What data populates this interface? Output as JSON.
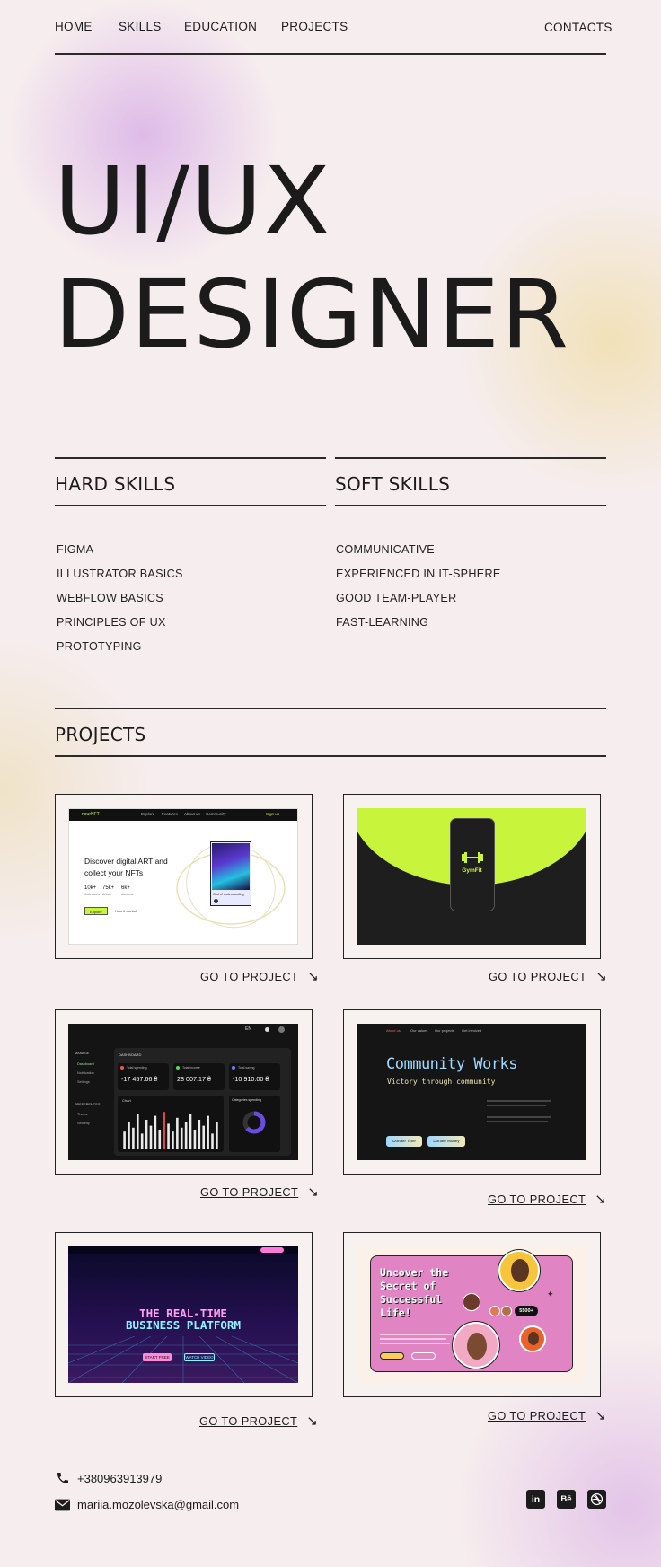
{
  "nav": {
    "home": "HOME",
    "skills": "SKILLS",
    "education": "EDUCATION",
    "projects": "PROJECTS",
    "contacts": "CONTACTS"
  },
  "hero": {
    "line1": "UI/UX",
    "line2": "DESIGNER"
  },
  "hard_skills": {
    "title": "HARD SKILLS",
    "items": [
      "FIGMA",
      "ILLUSTRATOR BASICS",
      "WEBFLOW BASICS",
      "PRINCIPLES OF UX",
      "PROTOTYPING"
    ]
  },
  "soft_skills": {
    "title": "SOFT SKILLS",
    "items": [
      "COMMUNICATIVE",
      "EXPERIENCED IN IT-SPHERE",
      "GOOD TEAM-PLAYER",
      "FAST-LEARNING"
    ]
  },
  "projects": {
    "title": "PROJECTS",
    "link_label": "GO TO PROJECT",
    "arrow": "↘",
    "nft": {
      "logo": "nourNFT",
      "nav": [
        "Explore",
        "Features",
        "About us",
        "Community"
      ],
      "signup": "Sign up",
      "headline": "Discover digital ART and collect your NFTs",
      "stats": [
        {
          "value": "10k+",
          "label": "Collections"
        },
        {
          "value": "75k+",
          "label": "Artists"
        },
        {
          "value": "6k+",
          "label": "Auctions"
        }
      ],
      "explore_btn": "Explore",
      "how": "How it works?",
      "card_title": "God of understanding"
    },
    "gym": {
      "name": "GymFit"
    },
    "dashboard": {
      "lang": "EN",
      "manage": "MANAGE",
      "menu": [
        "Dashboard",
        "Notification",
        "Settings"
      ],
      "prefs": "PREFERENCES",
      "prefs_items": [
        "Theme",
        "Security"
      ],
      "title": "DASHBOARD",
      "cards": [
        {
          "label": "Total spending",
          "value": "-17 457.66 ₴"
        },
        {
          "label": "Total income",
          "value": "28 007.17 ₴"
        },
        {
          "label": "Total saving",
          "value": "-10 910.00 ₴"
        }
      ],
      "chart_label": "Chart",
      "categories": "Categories spending",
      "bars": [
        0.45,
        0.7,
        0.55,
        0.9,
        0.4,
        0.75,
        0.6,
        0.85,
        0.5,
        0.95,
        0.65,
        0.45,
        0.8,
        0.55,
        0.7,
        0.9,
        0.5,
        0.75,
        0.6,
        0.85,
        0.4,
        0.7
      ]
    },
    "community": {
      "nav": [
        "About us",
        "Our values",
        "Our projects",
        "Get involved"
      ],
      "title": "Community Works",
      "subtitle": "Victory through community",
      "btn1": "Donate Time",
      "btn2": "Donate Money"
    },
    "business": {
      "title_line1": "THE REAL-TIME",
      "title_line2": "BUSINESS PLATFORM",
      "btn1": "START FREE",
      "btn2": "WATCH VIDEO"
    },
    "secret": {
      "title": "Uncover the Secret of Successful Life!",
      "badge": "5500+"
    }
  },
  "contacts": {
    "phone": "+380963913979",
    "email": "mariia.mozolevska@gmail.com",
    "socials": [
      "in",
      "Bē",
      "dribbble-icon"
    ]
  },
  "colors": {
    "accent_lime": "#c8f53c",
    "pink": "#e084c4",
    "dark": "#1b1b1b"
  }
}
